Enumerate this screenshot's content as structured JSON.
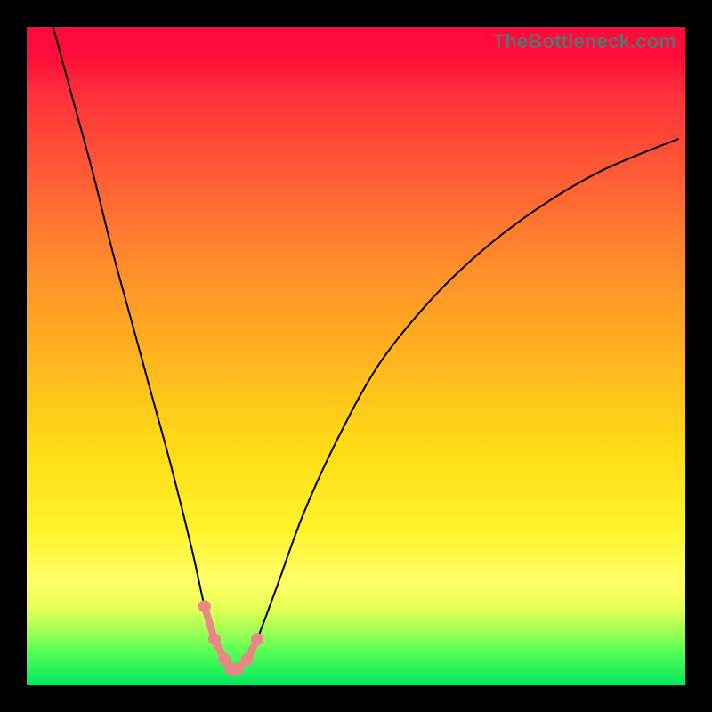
{
  "watermark": "TheBottleneck.com",
  "colors": {
    "background": "#000000",
    "gradient_top": "#ff0a3a",
    "gradient_bottom": "#00e85e",
    "curve": "#000000",
    "dots": "#e98686"
  },
  "chart_data": {
    "type": "line",
    "title": "",
    "xlabel": "",
    "ylabel": "",
    "xlim": [
      0,
      100
    ],
    "ylim": [
      0,
      100
    ],
    "grid": false,
    "legend": false,
    "annotations": [
      "TheBottleneck.com"
    ],
    "series": [
      {
        "name": "bottleneck-curve",
        "x": [
          4,
          7,
          10,
          13,
          16,
          19,
          22,
          25,
          27,
          28.5,
          30,
          31,
          32,
          33.5,
          35,
          38,
          42,
          47,
          53,
          60,
          68,
          77,
          87,
          99
        ],
        "y": [
          100,
          89,
          78,
          66,
          55,
          44,
          33,
          21,
          12,
          7,
          4,
          2.5,
          2.5,
          4,
          7,
          15,
          26,
          37,
          48,
          57,
          65,
          72,
          78,
          83
        ]
      }
    ],
    "highlight_points": {
      "name": "trough-dots",
      "x": [
        27,
        28.5,
        30,
        31,
        32,
        33.5,
        35
      ],
      "y": [
        12,
        7,
        4,
        2.5,
        2.5,
        4,
        7
      ]
    }
  }
}
